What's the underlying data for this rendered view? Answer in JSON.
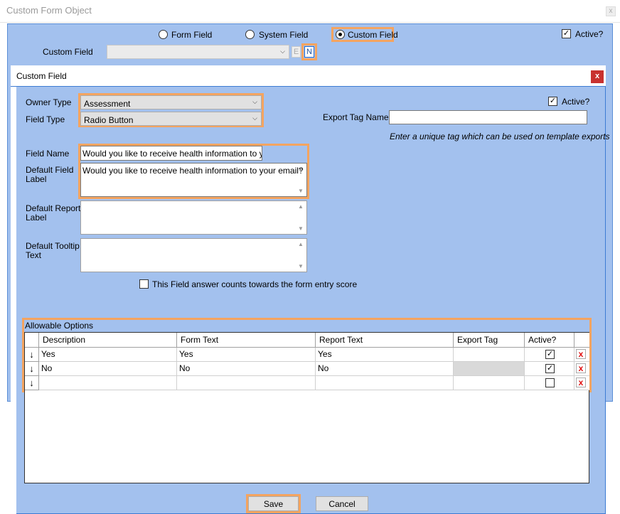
{
  "outer_window": {
    "title": "Custom Form Object",
    "close_glyph": "x",
    "source_options": [
      {
        "label": "Form Field",
        "selected": false
      },
      {
        "label": "System Field",
        "selected": false
      },
      {
        "label": "Custom Field",
        "selected": true
      }
    ],
    "active_label": "Active?",
    "active_checked": true,
    "custom_field_label": "Custom Field",
    "custom_field_value": "",
    "edit_button": "E",
    "new_button": "N"
  },
  "dialog": {
    "title": "Custom Field",
    "close_glyph": "x",
    "owner_type_label": "Owner Type",
    "owner_type_value": "Assessment",
    "field_type_label": "Field Type",
    "field_type_value": "Radio Button",
    "active_label": "Active?",
    "active_checked": true,
    "export_tag_label": "Export Tag Name",
    "export_tag_value": "",
    "export_tag_hint": "Enter a unique tag which can be used on template exports",
    "field_name_label": "Field Name",
    "field_name_value": "Would you like to receive health information to your e",
    "default_field_label_line1": "Default Field",
    "default_field_label_line2": "Label",
    "default_field_label_value": "Would you like to receive health information to your email?",
    "default_report_label_line1": "Default Report",
    "default_report_label_line2": "Label",
    "default_report_label_value": "",
    "default_tooltip_line1": "Default Tooltip",
    "default_tooltip_line2": "Text",
    "default_tooltip_value": "",
    "score_checkbox_label": "This Field answer counts towards the form entry score",
    "score_checked": false,
    "allowable_options_label": "Allowable Options",
    "grid": {
      "columns": [
        "Description",
        "Form Text",
        "Report Text",
        "Export Tag",
        "Active?"
      ],
      "rows": [
        {
          "description": "Yes",
          "form_text": "Yes",
          "report_text": "Yes",
          "export_tag": "",
          "active": true
        },
        {
          "description": "No",
          "form_text": "No",
          "report_text": "No",
          "export_tag": "",
          "active": true
        },
        {
          "description": "",
          "form_text": "",
          "report_text": "",
          "export_tag": "",
          "active": false
        }
      ],
      "row_glyph": "↓",
      "delete_glyph": "x",
      "check_glyph": "✓"
    },
    "save_label": "Save",
    "cancel_label": "Cancel"
  },
  "colors": {
    "panel_bg": "#a3c1ee",
    "highlight": "#f4a460",
    "window_border": "#3d7bd3",
    "close_red": "#c8312f"
  }
}
